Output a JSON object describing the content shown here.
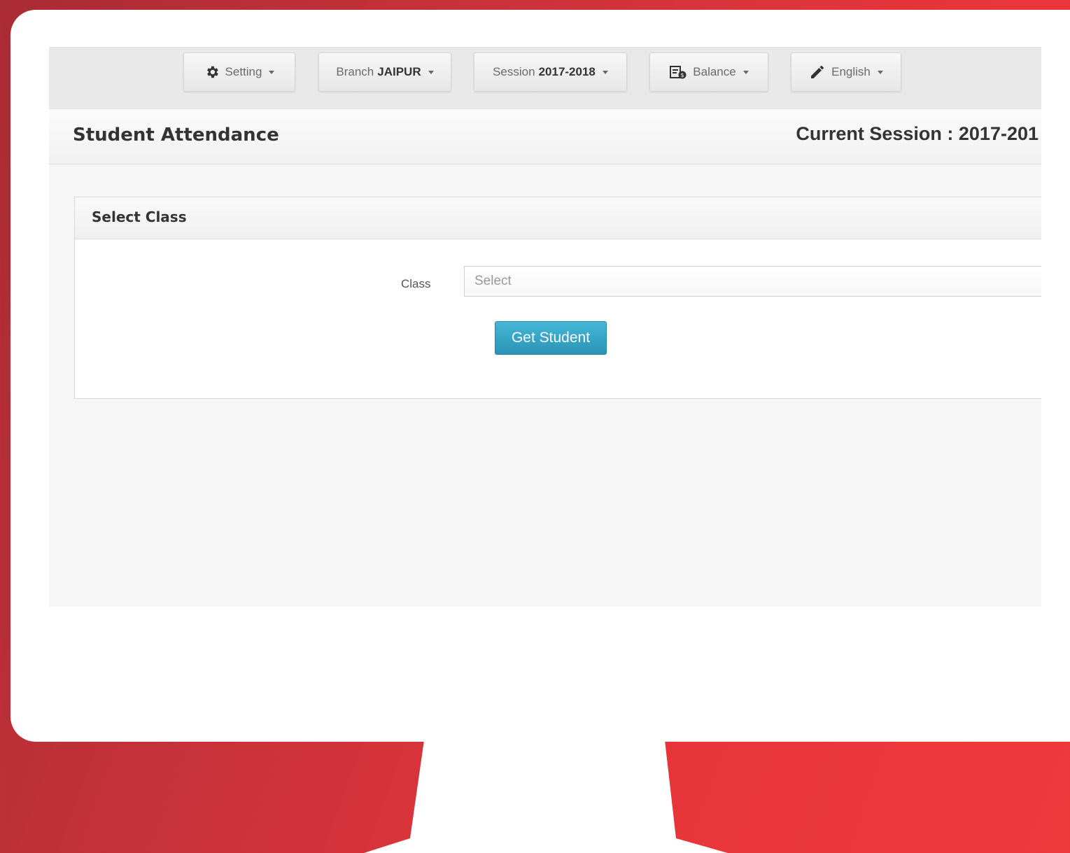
{
  "topbar": {
    "setting": {
      "label": "Setting",
      "icon": "gear-icon"
    },
    "branch": {
      "prefix": "Branch",
      "value": "JAIPUR"
    },
    "session": {
      "prefix": "Session",
      "value": "2017-2018"
    },
    "balance": {
      "label": "Balance",
      "icon": "balance-icon"
    },
    "language": {
      "label": "English",
      "icon": "pencil-icon"
    }
  },
  "page": {
    "title": "Student Attendance",
    "current_session": "Current Session : 2017-201"
  },
  "panel": {
    "title": "Select Class",
    "class_label": "Class",
    "class_select_value": "Select",
    "submit_label": "Get Student"
  },
  "colors": {
    "background_red": "#e8353a",
    "primary_button": "#2a94b7"
  }
}
